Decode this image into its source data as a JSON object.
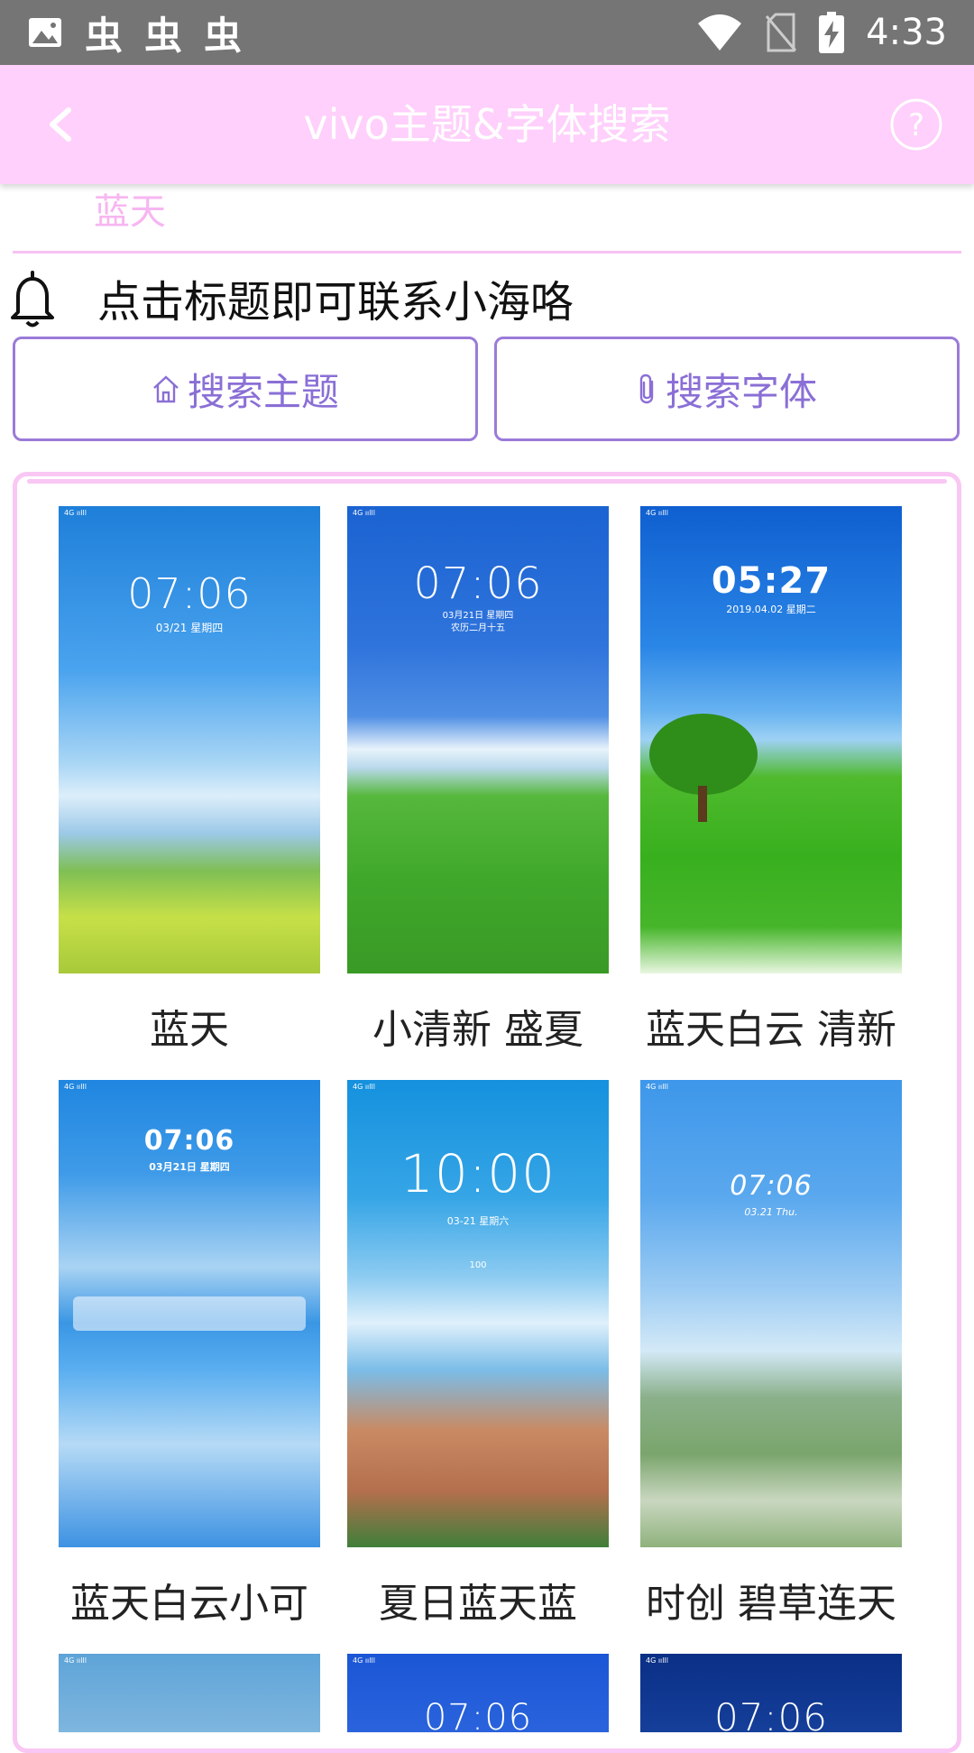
{
  "status_bar": {
    "time": "4:33",
    "left_icons": [
      "image-icon",
      "app-icon",
      "app-icon",
      "app-icon"
    ],
    "app_glyph": "虫",
    "right_icons": [
      "wifi-icon",
      "no-sim-icon",
      "battery-charging-icon"
    ]
  },
  "toolbar": {
    "title": "vivo主题&字体搜索",
    "back_icon": "back-arrow-icon",
    "help_icon": "help-icon"
  },
  "subheading": "蓝天",
  "notice": {
    "icon": "bell-icon",
    "text": "点击标题即可联系小海咯"
  },
  "buttons": {
    "search_theme": "搜索主题",
    "search_font": "搜索字体"
  },
  "themes": [
    {
      "name": "蓝天",
      "clock": "07:06",
      "date": "03/21  星期四"
    },
    {
      "name": "小清新 盛夏",
      "clock": "07:06",
      "date": "03月21日 星期四",
      "date2": "农历二月十五"
    },
    {
      "name": "蓝天白云 清新",
      "clock": "05:27",
      "date": "2019.04.02  星期二"
    },
    {
      "name": "蓝天白云小可",
      "clock": "07:06",
      "date": "03月21日 星期四"
    },
    {
      "name": "夏日蓝天蓝",
      "clock": "10:00",
      "date": "03-21     星期六",
      "temp": "100"
    },
    {
      "name": "时创 碧草连天",
      "clock": "07:06",
      "date": "03.21   Thu."
    },
    {
      "name": "",
      "clock": "",
      "date": ""
    },
    {
      "name": "",
      "clock": "07:06",
      "date": ""
    },
    {
      "name": "",
      "clock": "07:06",
      "date": ""
    }
  ],
  "colors": {
    "toolbar_bg": "#ffd0fb",
    "accent_purple": "#8a6fd6",
    "pink_border": "#f9c7f3",
    "status_bar_bg": "#757575"
  }
}
